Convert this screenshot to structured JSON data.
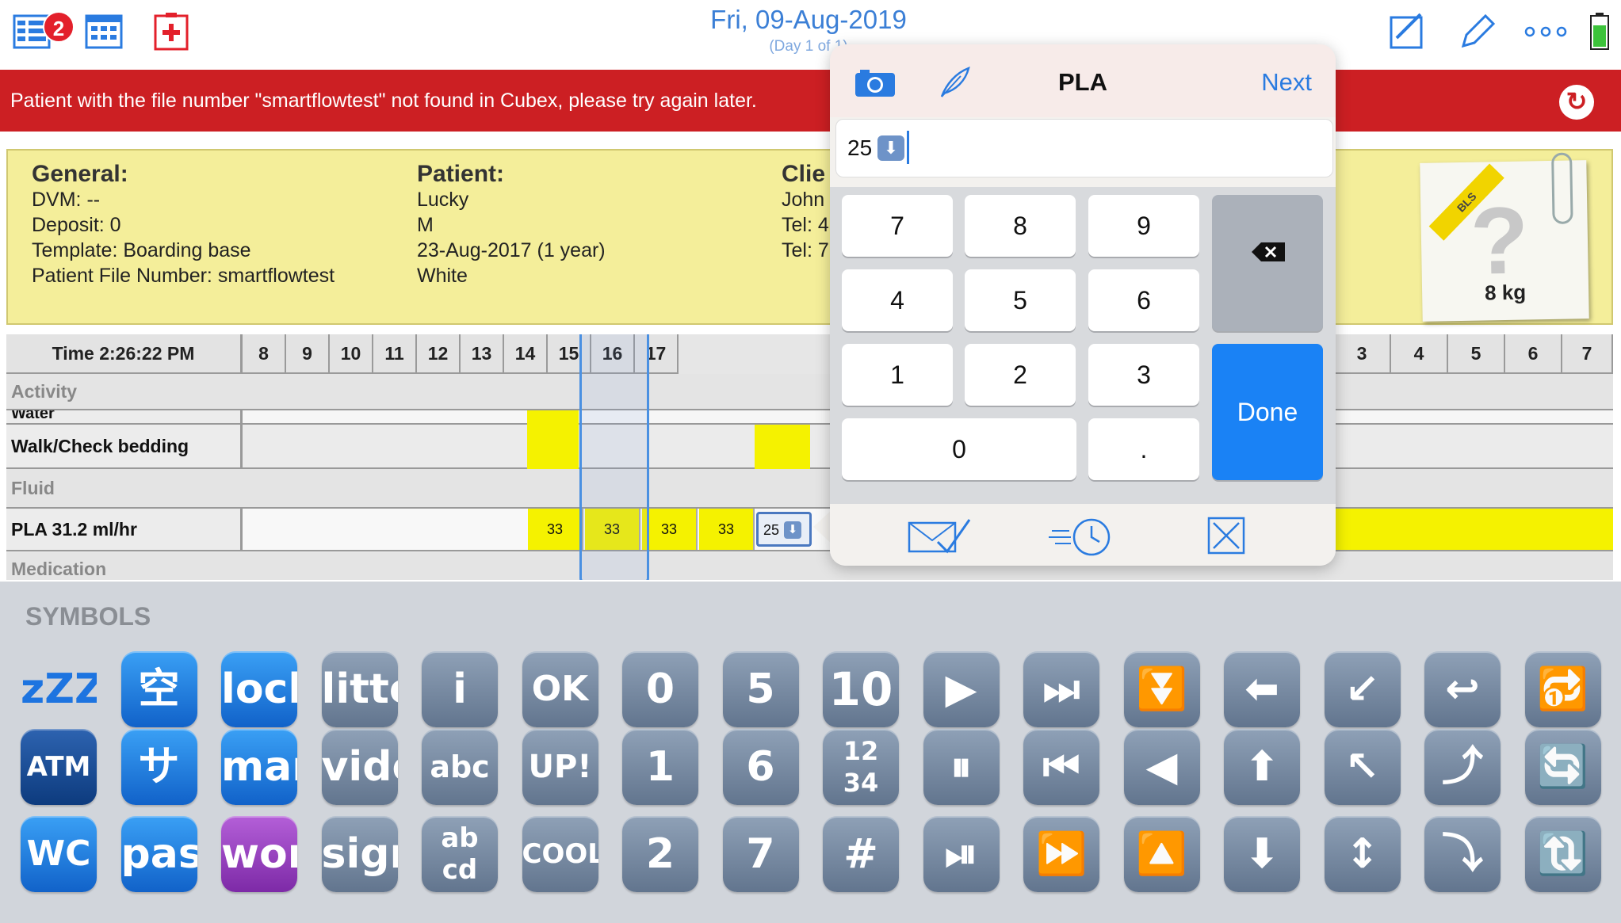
{
  "topbar": {
    "badge": "2",
    "date": "Fri, 09-Aug-2019",
    "day": "(Day 1 of 1)"
  },
  "banner": {
    "message": "Patient with the file number \"smartflowtest\" not found in Cubex, please try again later."
  },
  "info": {
    "general": {
      "heading": "General:",
      "lines": [
        "DVM: --",
        "Deposit: 0",
        "Template: Boarding base",
        "Patient File Number: smartflowtest"
      ]
    },
    "patient": {
      "heading": "Patient:",
      "lines": [
        "Lucky",
        "M",
        "23-Aug-2017 (1 year)",
        "White"
      ]
    },
    "client": {
      "heading": "Clie",
      "lines": [
        "John",
        "Tel: 4",
        "Tel: 7"
      ]
    },
    "photo": {
      "tag": "BLS",
      "weight": "8 kg"
    }
  },
  "grid": {
    "time_label": "Time 2:26:22 PM",
    "hours_left": [
      "8",
      "9",
      "10",
      "11",
      "12",
      "13",
      "14",
      "15",
      "16",
      "17"
    ],
    "hours_right": [
      "3",
      "4",
      "5",
      "6",
      "7"
    ],
    "rows": {
      "activity": "Activity",
      "water": "Water",
      "walk": "Walk/Check bedding",
      "fluid": "Fluid",
      "pla": "PLA 31.2 ml/hr",
      "medication": "Medication"
    },
    "pla_values": [
      "33",
      "33",
      "33",
      "33"
    ],
    "pla_current": "25"
  },
  "popover": {
    "title": "PLA",
    "next_label": "Next",
    "input_value": "25",
    "keys": [
      "7",
      "8",
      "9",
      "4",
      "5",
      "6",
      "1",
      "2",
      "3",
      "0",
      "."
    ],
    "done_label": "Done"
  },
  "keyboard": {
    "title": "SYMBOLS",
    "row1": [
      "zZZ",
      "空",
      "locker",
      "litter",
      "i",
      "OK",
      "0",
      "5",
      "10",
      "▶",
      "⏭",
      "⏬",
      "⬅",
      "↙",
      "↩",
      "🔂"
    ],
    "row2": [
      "ATM",
      "サ",
      "man",
      "video",
      "abc",
      "UP!",
      "1",
      "6",
      "12 34",
      "⏸",
      "⏮",
      "◀",
      "⬆",
      "↖",
      "⤴",
      "🔄"
    ],
    "row3": [
      "WC",
      "passport",
      "woman",
      "signal",
      "ab cd",
      "COOL",
      "2",
      "7",
      "#",
      "⏯",
      "⏩",
      "🔼",
      "⬇",
      "↕",
      "⤵",
      "🔃"
    ]
  }
}
